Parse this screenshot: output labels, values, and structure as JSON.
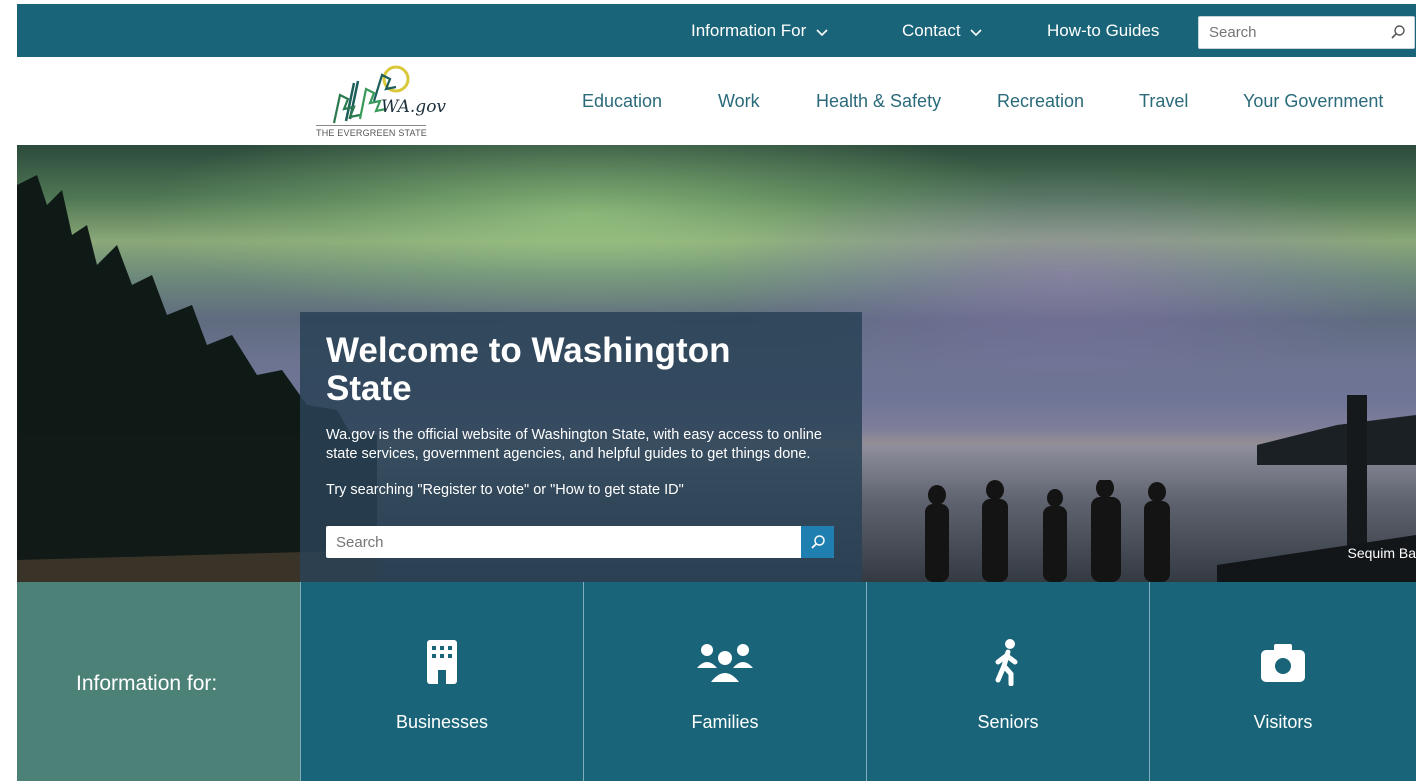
{
  "utility_nav": {
    "information_for": "Information For",
    "contact": "Contact",
    "how_to_guides": "How-to Guides",
    "search_placeholder": "Search"
  },
  "logo": {
    "text": "WA.gov",
    "tagline": "THE EVERGREEN STATE"
  },
  "main_nav": [
    "Education",
    "Work",
    "Health & Safety",
    "Recreation",
    "Travel",
    "Your Government"
  ],
  "hero": {
    "title": "Welcome to Washington State",
    "description": "Wa.gov is the official website of Washington State, with easy access to online state services, government agencies, and helpful guides to get things done.",
    "try_text": "Try searching \"Register to vote\" or \"How to get state ID\"",
    "search_placeholder": "Search",
    "photo_caption": "Sequim Ba"
  },
  "info_for": {
    "label": "Information for:",
    "tiles": [
      {
        "label": "Businesses",
        "icon": "building-icon"
      },
      {
        "label": "Families",
        "icon": "family-icon"
      },
      {
        "label": "Seniors",
        "icon": "walking-person-icon"
      },
      {
        "label": "Visitors",
        "icon": "camera-icon"
      }
    ]
  },
  "colors": {
    "top_bar": "#1a6479",
    "tile_bg": "#1a6479",
    "info_label_bg": "#4c8178",
    "nav_text": "#2a6a7a",
    "search_button": "#1e7fb0"
  }
}
